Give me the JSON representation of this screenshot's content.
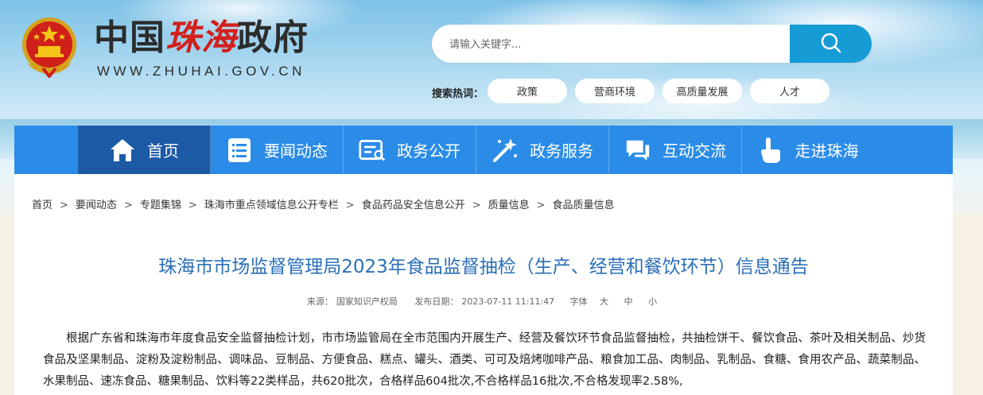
{
  "header": {
    "title_part1": "中国",
    "title_accent": "珠海",
    "title_part2": "政府",
    "domain": "WWW.ZHUHAI.GOV.CN"
  },
  "search": {
    "placeholder": "请输入关键字..."
  },
  "hotwords": {
    "label": "搜索热词：",
    "items": [
      "政策",
      "营商环境",
      "高质量发展",
      "人才"
    ]
  },
  "nav": {
    "items": [
      {
        "label": "首页",
        "icon": "home-icon"
      },
      {
        "label": "要闻动态",
        "icon": "news-list-icon"
      },
      {
        "label": "政务公开",
        "icon": "document-icon"
      },
      {
        "label": "政务服务",
        "icon": "magic-wand-icon"
      },
      {
        "label": "互动交流",
        "icon": "chat-icon"
      },
      {
        "label": "走进珠海",
        "icon": "pointer-hand-icon"
      }
    ]
  },
  "breadcrumb": [
    "首页",
    "要闻动态",
    "专题集锦",
    "珠海市重点领域信息公开专栏",
    "食品药品安全信息公开",
    "质量信息",
    "食品质量信息"
  ],
  "article": {
    "title": "珠海市市场监督管理局2023年食品监督抽检（生产、经营和餐饮环节）信息通告",
    "source_label": "来源：",
    "source": "国家知识产权局",
    "date_label": "发布日期：",
    "date": "2023-07-11 11:11:47",
    "font_label": "字体",
    "font_large": "大",
    "font_medium": "中",
    "font_small": "小",
    "body": "根据广东省和珠海市年度食品安全监督抽检计划，市市场监管局在全市范围内开展生产、经营及餐饮环节食品监督抽检，共抽检饼干、餐饮食品、茶叶及相关制品、炒货食品及坚果制品、淀粉及淀粉制品、调味品、豆制品、方便食品、糕点、罐头、酒类、可可及焙烤咖啡产品、粮食加工品、肉制品、乳制品、食糖、食用农产品、蔬菜制品、水果制品、速冻食品、糖果制品、饮料等22类样品，共620批次，合格样品604批次,不合格样品16批次,不合格发现率2.58%,"
  },
  "colors": {
    "nav_bg": "#2b8ce8",
    "nav_active": "#1c5aa6",
    "search_button": "#169bd5",
    "title_blue": "#2a6fb7",
    "accent_red": "#d2201b"
  }
}
